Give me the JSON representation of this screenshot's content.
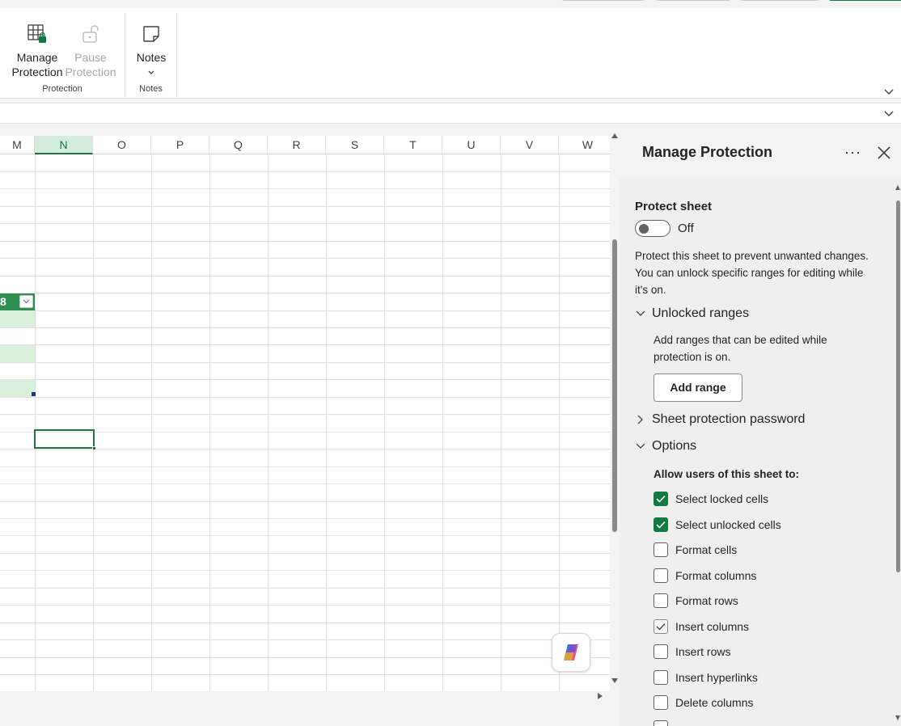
{
  "ribbon": {
    "manage_protection_line1": "Manage",
    "manage_protection_line2": "Protection",
    "pause_protection_line1": "Pause",
    "pause_protection_line2": "Protection",
    "protection_group_label": "Protection",
    "notes_label": "Notes",
    "notes_group_label": "Notes"
  },
  "grid": {
    "columns": [
      "M",
      "N",
      "O",
      "P",
      "Q",
      "R",
      "S",
      "T",
      "U",
      "V",
      "W"
    ],
    "selected_column": "N",
    "table_header_fragment": "8"
  },
  "panel": {
    "title": "Manage Protection",
    "more_label": "···",
    "protect_sheet_label": "Protect sheet",
    "toggle_state": "Off",
    "description": "Protect this sheet to prevent unwanted changes. You can unlock specific ranges for editing while it's on.",
    "unlocked_ranges": {
      "heading": "Unlocked ranges",
      "description": "Add ranges that can be edited while protection is on.",
      "add_button": "Add range"
    },
    "password_heading": "Sheet protection password",
    "options": {
      "heading": "Options",
      "allow_label": "Allow users of this sheet to:",
      "items": [
        {
          "label": "Select locked cells",
          "checked": true
        },
        {
          "label": "Select unlocked cells",
          "checked": true
        },
        {
          "label": "Format cells",
          "checked": false
        },
        {
          "label": "Format columns",
          "checked": false
        },
        {
          "label": "Format rows",
          "checked": false
        },
        {
          "label": "Insert columns",
          "checked": true
        },
        {
          "label": "Insert rows",
          "checked": false
        },
        {
          "label": "Insert hyperlinks",
          "checked": false
        },
        {
          "label": "Delete columns",
          "checked": false
        }
      ]
    }
  },
  "colors": {
    "accent": "#0f7b3f",
    "selection": "#217346",
    "band": "#d9f0dc"
  }
}
